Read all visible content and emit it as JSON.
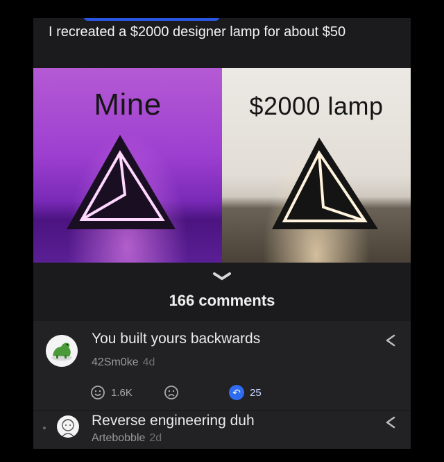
{
  "post": {
    "title": "I recreated a $2000 designer lamp for about $50",
    "image": {
      "left_label": "Mine",
      "right_label": "$2000 lamp"
    }
  },
  "comments_section": {
    "count_label": "166 comments"
  },
  "comments": [
    {
      "text": "You built yours backwards",
      "author": "42Sm0ke",
      "age": "4d",
      "upvotes": "1.6K",
      "replies": "25",
      "avatar": "dinosaur-avatar"
    },
    {
      "text": "Reverse engineering duh",
      "author": "Artebobble",
      "age": "2d",
      "avatar": "sketch-face-avatar"
    }
  ],
  "colors": {
    "accent": "#2e6cf0",
    "background": "#1b1b1d"
  }
}
